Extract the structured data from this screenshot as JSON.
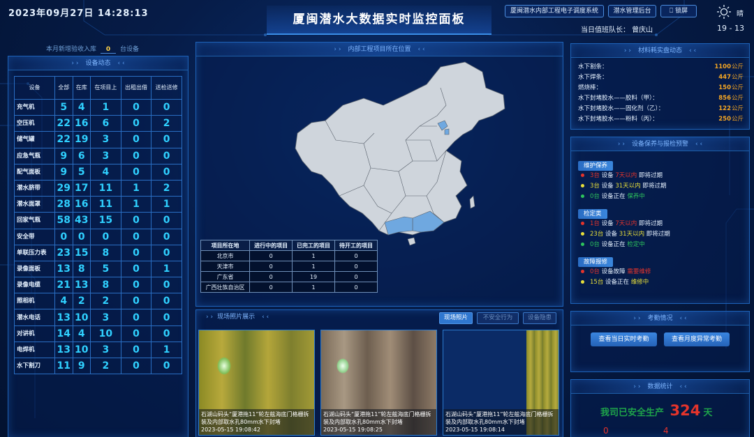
{
  "header": {
    "datetime": "2023年09月27日  14:28:13",
    "title": "厦闽潜水大数据实时监控面板",
    "btn_dispatch": "厦闽潜水内部工程电子调度系统",
    "btn_admin": "潜水管理后台",
    "btn_lock": "锁屏",
    "captain": "当日值班队长：  曾庆山",
    "weather": "晴",
    "temperature": "19 - 13"
  },
  "equipment": {
    "new_intake_label": "本月新增验收入库",
    "new_intake_value": "0",
    "new_intake_unit": "台设备",
    "panel_title": "设备动态",
    "columns": [
      "设备",
      "全部",
      "在库",
      "在项目上",
      "出租出借",
      "送检送修"
    ],
    "rows": [
      [
        "充气机",
        "5",
        "4",
        "1",
        "0",
        "0"
      ],
      [
        "空压机",
        "22",
        "16",
        "6",
        "0",
        "2"
      ],
      [
        "储气罐",
        "22",
        "19",
        "3",
        "0",
        "0"
      ],
      [
        "应急气瓶",
        "9",
        "6",
        "3",
        "0",
        "0"
      ],
      [
        "配气面板",
        "9",
        "5",
        "4",
        "0",
        "0"
      ],
      [
        "潜水脐带",
        "29",
        "17",
        "11",
        "1",
        "2"
      ],
      [
        "潜水面罩",
        "28",
        "16",
        "11",
        "1",
        "1"
      ],
      [
        "回家气瓶",
        "58",
        "43",
        "15",
        "0",
        "0"
      ],
      [
        "安全带",
        "0",
        "0",
        "0",
        "0",
        "0"
      ],
      [
        "单联压力表",
        "23",
        "15",
        "8",
        "0",
        "0"
      ],
      [
        "录像面板",
        "13",
        "8",
        "5",
        "0",
        "1"
      ],
      [
        "录像电缆",
        "21",
        "13",
        "8",
        "0",
        "0"
      ],
      [
        "照相机",
        "4",
        "2",
        "2",
        "0",
        "0"
      ],
      [
        "潜水电话",
        "13",
        "10",
        "3",
        "0",
        "0"
      ],
      [
        "对讲机",
        "14",
        "4",
        "10",
        "0",
        "0"
      ],
      [
        "电焊机",
        "13",
        "10",
        "3",
        "0",
        "1"
      ],
      [
        "水下割刀",
        "11",
        "9",
        "2",
        "0",
        "0"
      ]
    ]
  },
  "map": {
    "panel_title": "内部工程项目所在位置",
    "columns": [
      "项目所在地",
      "进行中的项目",
      "已完工的项目",
      "待开工的项目"
    ],
    "rows": [
      [
        "北京市",
        "0",
        "1",
        "0"
      ],
      [
        "天津市",
        "0",
        "1",
        "0"
      ],
      [
        "广东省",
        "0",
        "19",
        "0"
      ],
      [
        "广西壮族自治区",
        "0",
        "1",
        "0"
      ]
    ],
    "colors": {
      "land": "#cfd5dc",
      "highlight": "#6fa8e0",
      "border": "#58606b"
    }
  },
  "photos": {
    "panel_title": "现场照片展示",
    "tabs": [
      "现场照片",
      "不安全行为",
      "设备隐患"
    ],
    "items": [
      {
        "caption": "石湖山码头“厦港拖11”轮左舷海底门格栅拆装及内部取水孔80mm水下封堵",
        "time": "2023-05-15 19:08:42"
      },
      {
        "caption": "石湖山码头“厦港拖11”轮左舷海底门格栅拆装及内部取水孔80mm水下封堵",
        "time": "2023-05-15 19:08:25"
      },
      {
        "caption": "石湖山码头“厦港拖11”轮左舷海底门格栅拆装及内部取水孔80mm水下封堵",
        "time": "2023-05-15 19:08:14"
      }
    ]
  },
  "materials": {
    "panel_title": "材料耗实盘动态",
    "unit": "公斤",
    "items": [
      {
        "name": "水下割条：",
        "value": "1100"
      },
      {
        "name": "水下焊条：",
        "value": "447"
      },
      {
        "name": "燃烧棒：",
        "value": "150"
      },
      {
        "name": "水下封堵胶水——胶料（甲）：",
        "value": "856"
      },
      {
        "name": "水下封堵胶水——固化剂（乙）：",
        "value": "122"
      },
      {
        "name": "水下封堵胶水——粉料（丙）：",
        "value": "250"
      }
    ]
  },
  "maintenance": {
    "panel_title": "设备保养与报检预警",
    "sections": [
      {
        "title": "维护保养",
        "items": [
          {
            "c": "red",
            "count": "3台",
            "mid": "设备",
            "hl": "7天以内",
            "tail": "即将过期"
          },
          {
            "c": "yel",
            "count": "3台",
            "mid": "设备",
            "hl": "31天以内",
            "tail": "即将过期"
          },
          {
            "c": "grn",
            "count": "0台",
            "mid": "设备正在",
            "hl": "保养中",
            "tail": ""
          }
        ]
      },
      {
        "title": "检定类",
        "items": [
          {
            "c": "red",
            "count": "1台",
            "mid": "设备",
            "hl": "7天以内",
            "tail": "即将过期"
          },
          {
            "c": "yel",
            "count": "23台",
            "mid": "设备",
            "hl": "31天以内",
            "tail": "即将过期"
          },
          {
            "c": "grn",
            "count": "0台",
            "mid": "设备正在",
            "hl": "检定中",
            "tail": ""
          }
        ]
      },
      {
        "title": "故障报修",
        "items": [
          {
            "c": "red",
            "count": "0台",
            "mid": "设备故障",
            "hl": "需要维修",
            "tail": ""
          },
          {
            "c": "yel",
            "count": "15台",
            "mid": "设备正在",
            "hl": "维修中",
            "tail": ""
          }
        ]
      }
    ]
  },
  "attendance": {
    "panel_title": "考勤情况",
    "btn_today": "查看当日实时考勤",
    "btn_month": "查看月度异常考勤"
  },
  "stats": {
    "panel_title": "数据统计",
    "safe_label": "我司已安全生产",
    "safe_days": "324",
    "safe_unit": "天",
    "bottom_left": "0",
    "bottom_right": "4"
  }
}
